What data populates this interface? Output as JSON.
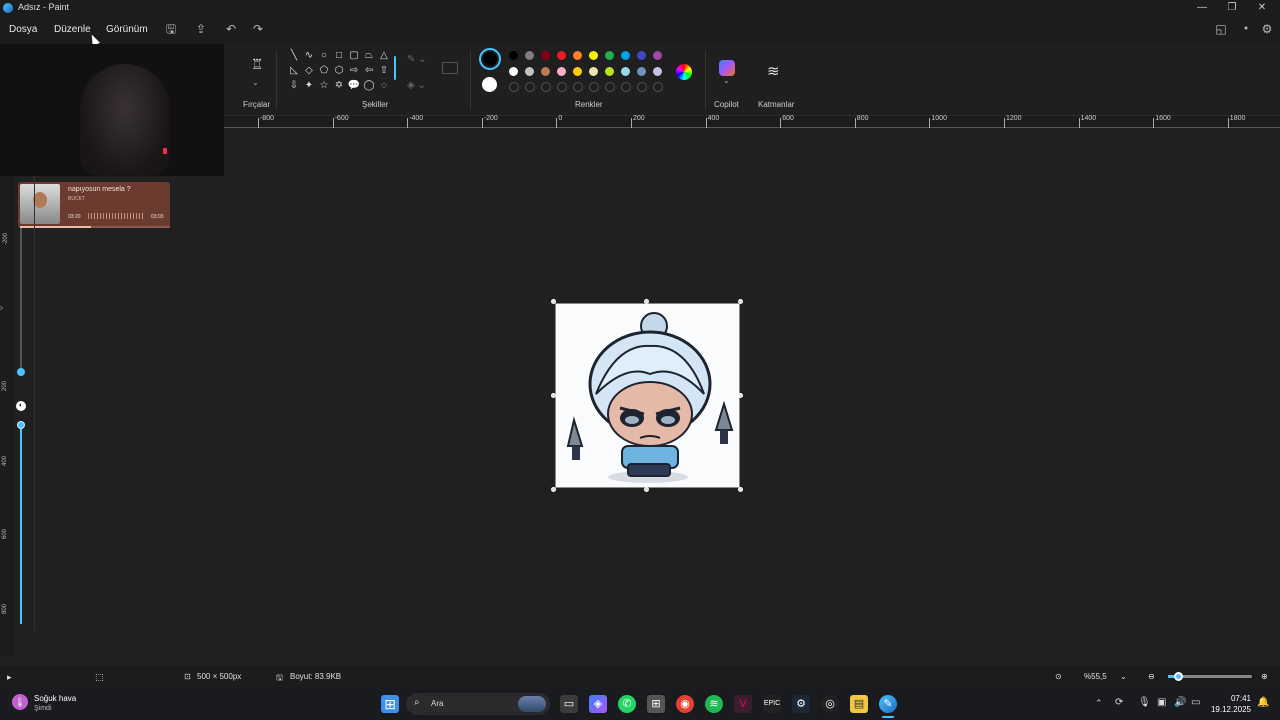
{
  "window": {
    "title": "Adsız - Paint"
  },
  "menu": {
    "file": "Dosya",
    "edit": "Düzenle",
    "view": "Görünüm"
  },
  "ribbon": {
    "brushes_label": "Fırçalar",
    "shapes_label": "Şekiller",
    "colors_label": "Renkler",
    "copilot_label": "Copilot",
    "layers_label": "Katmanlar",
    "swatches_row1": [
      "#000000",
      "#7f7f7f",
      "#880015",
      "#ed1c24",
      "#ff7f27",
      "#fff200",
      "#22b14c",
      "#00a2e8",
      "#3f48cc",
      "#a349a4"
    ],
    "swatches_row2": [
      "#ffffff",
      "#c3c3c3",
      "#b97a57",
      "#ffaec9",
      "#ffc90e",
      "#efe4b0",
      "#b5e61d",
      "#99d9ea",
      "#7092be",
      "#c8bfe7"
    ],
    "primary_color": "#000000",
    "secondary_color": "#ffffff"
  },
  "ruler": {
    "labels": [
      "-800",
      "-600",
      "-400",
      "-200",
      "0",
      "200",
      "400",
      "600",
      "800",
      "1000",
      "1200",
      "1400",
      "1600",
      "1800"
    ]
  },
  "vruler": {
    "labels": [
      "-200",
      "0",
      "200",
      "400",
      "600",
      "800"
    ]
  },
  "music_widget": {
    "title": "napıyosun mesela ?",
    "artist": "BUCKT",
    "time_current": "03:20",
    "time_total": "03:03"
  },
  "status": {
    "dimensions": "500 × 500px",
    "size": "Boyut: 83.9KB",
    "zoom": "%55,5"
  },
  "taskbar": {
    "weather_title": "Soğuk hava",
    "weather_sub": "Şimdi",
    "search_placeholder": "Ara",
    "time": "07:41",
    "date": "19.12.2025"
  },
  "colors": {
    "accent": "#4cc2ff",
    "music_bg": "#6b3b30"
  }
}
